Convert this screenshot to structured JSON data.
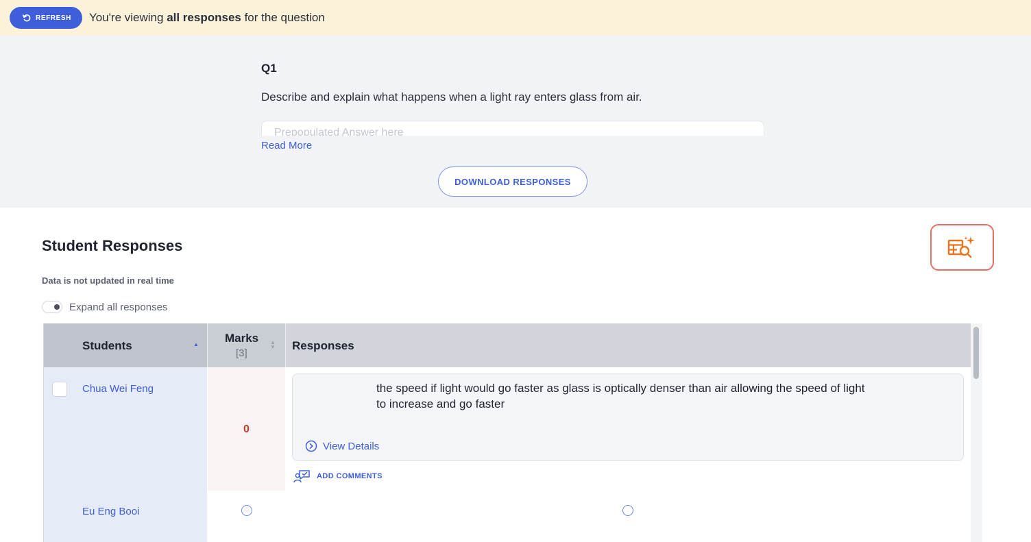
{
  "banner": {
    "refresh_label": "REFRESH",
    "text_prefix": "You're viewing ",
    "text_bold": "all responses",
    "text_suffix": " for the question"
  },
  "question": {
    "label": "Q1",
    "text": "Describe and explain what happens when a light ray enters glass from air.",
    "answer_placeholder": "Prepopulated Answer here",
    "read_more": "Read More",
    "download_label": "DOWNLOAD RESPONSES"
  },
  "responses_section": {
    "title": "Student Responses",
    "note": "Data is not updated in real time",
    "expand_label": "Expand all responses",
    "ai_button_icon": "ai-table-search-icon",
    "accent_color": "#e8741e"
  },
  "table": {
    "columns": {
      "students": "Students",
      "marks": "Marks",
      "marks_total": "[3]",
      "responses": "Responses"
    },
    "rows": [
      {
        "student": "Chua Wei Feng",
        "mark": "0",
        "response": "the speed if light would go faster as glass is optically denser than air allowing the speed of light to increase and go faster",
        "view_details": "View Details",
        "add_comments": "ADD COMMENTS"
      },
      {
        "student": "Eu Eng Booi",
        "mark": "",
        "response": ""
      }
    ]
  },
  "colors": {
    "primary": "#3e5fd9",
    "banner_bg": "#fbf2d9",
    "mark_zero": "#c0392b",
    "ai_border": "#e66d63"
  }
}
